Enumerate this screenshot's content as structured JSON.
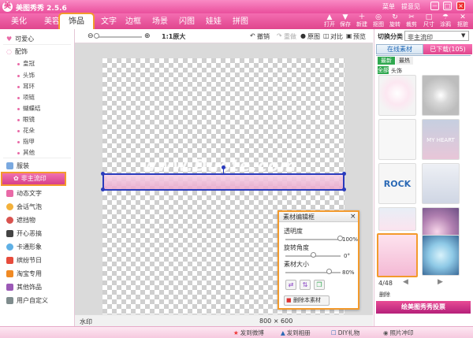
{
  "app": {
    "title": "美图秀秀 2.5.6",
    "menu": "菜单",
    "feedback": "提意见",
    "win_min": "－",
    "win_max": "□",
    "win_close": "×"
  },
  "tabs": [
    "美化",
    "美容",
    "饰品",
    "文字",
    "边框",
    "场景",
    "闪图",
    "娃娃",
    "拼图"
  ],
  "tools": [
    {
      "icon": "▲",
      "label": "打开"
    },
    {
      "icon": "▼",
      "label": "保存"
    },
    {
      "icon": "＋",
      "label": "新建"
    },
    {
      "icon": "◎",
      "label": "抠图"
    },
    {
      "icon": "↻",
      "label": "旋转"
    },
    {
      "icon": "✂",
      "label": "裁剪"
    },
    {
      "icon": "□",
      "label": "尺寸"
    },
    {
      "icon": "☂",
      "label": "涂鸦"
    },
    {
      "icon": "✕",
      "label": "抠脏"
    }
  ],
  "sidebar": {
    "top": "可爱心",
    "group": "配饰",
    "subitems": [
      "皇冠",
      "头饰",
      "耳环",
      "项链",
      "蝴蝶结",
      "眼镜",
      "花朵",
      "指甲",
      "其他"
    ],
    "items": [
      "服装",
      "非主流印",
      "动态文字",
      "会话气泡",
      "遮挡物",
      "开心恶搞",
      "卡通形象",
      "缤纷节日",
      "淘宝专用",
      "其他饰品",
      "用户自定义"
    ],
    "highlight_index": 1
  },
  "canvas_toolbar": {
    "zoom_ratio": "1:1原大",
    "undo": "撤销",
    "redo": "重做",
    "original": "原图",
    "compare": "对比",
    "preview": "预览"
  },
  "canvas": {
    "watermark": "www.Duote.com",
    "status_left": "水印",
    "status_size": "800 × 600"
  },
  "right": {
    "category_label": "切换分类",
    "category_value": "非主流印",
    "tab_online": "在线素材",
    "tab_downloaded": "已下载(105)",
    "sub_newest": "最新",
    "sub_hot": "最热",
    "tag_all": "全部",
    "tag_head": "头饰",
    "thumb_rock": "ROCK",
    "thumb_heart": "MY HEART",
    "page_info": "4/48",
    "delete_label": "删除",
    "banner": "绘美图秀秀投票"
  },
  "dialog": {
    "title": "素材编辑框",
    "close": "×",
    "opacity_label": "透明度",
    "opacity_value": "100%",
    "opacity": 1.0,
    "rotate_label": "旋转角度",
    "rotate_value": "0°",
    "size_label": "素材大小",
    "size_value": "80%",
    "size": 0.8,
    "delete_button": "删除本素材"
  },
  "bottombar": [
    {
      "icon": "★",
      "label": "发到微博"
    },
    {
      "icon": "▲",
      "label": "发到相册"
    },
    {
      "icon": "☐",
      "label": "DIY礼物"
    },
    {
      "icon": "◉",
      "label": "照片冲印"
    }
  ],
  "colors": {
    "pink": "#ea4e9c",
    "orange_highlight": "#f39a2c",
    "selection": "#2a3bbd"
  }
}
